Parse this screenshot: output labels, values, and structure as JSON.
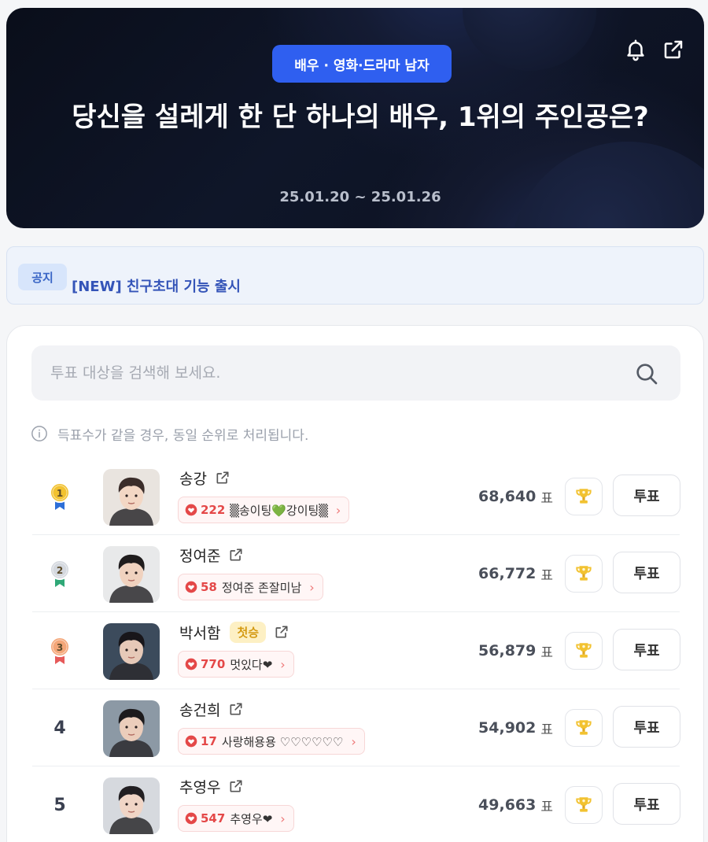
{
  "header": {
    "category": "배우 · 영화·드라마 남자",
    "title": "당신을 설레게 한 단 하나의 배우, 1위의 주인공은?",
    "period": "25.01.20 ~ 25.01.26"
  },
  "notice": {
    "tag": "공지",
    "text": "[NEW] 친구초대 기능 출시"
  },
  "search": {
    "placeholder": "투표 대상을 검색해 보세요."
  },
  "info_text": "득표수가 같을 경우, 동일 순위로 처리됩니다.",
  "vote_unit": "표",
  "vote_button_label": "투표",
  "colors": {
    "accent": "#2f5ff0",
    "gold": "#f2c230",
    "silver": "#c7ccd3",
    "bronze": "#f0a070",
    "cheer_red": "#e44848"
  },
  "candidates": [
    {
      "rank": "1",
      "medal": "gold",
      "name": "송강",
      "badge": "",
      "cheer_count": "222",
      "cheer_message": "▒송이팅💚강이팅▒",
      "votes": "68,640"
    },
    {
      "rank": "2",
      "medal": "silver",
      "name": "정여준",
      "badge": "",
      "cheer_count": "58",
      "cheer_message": "정여준 존잘미남",
      "votes": "66,772"
    },
    {
      "rank": "3",
      "medal": "bronze",
      "name": "박서함",
      "badge": "첫승",
      "cheer_count": "770",
      "cheer_message": "멋있다❤",
      "votes": "56,879"
    },
    {
      "rank": "4",
      "medal": "",
      "name": "송건희",
      "badge": "",
      "cheer_count": "17",
      "cheer_message": "사랑해용용 ♡♡♡♡♡♡",
      "votes": "54,902"
    },
    {
      "rank": "5",
      "medal": "",
      "name": "추영우",
      "badge": "",
      "cheer_count": "547",
      "cheer_message": "추영우❤",
      "votes": "49,663"
    }
  ]
}
